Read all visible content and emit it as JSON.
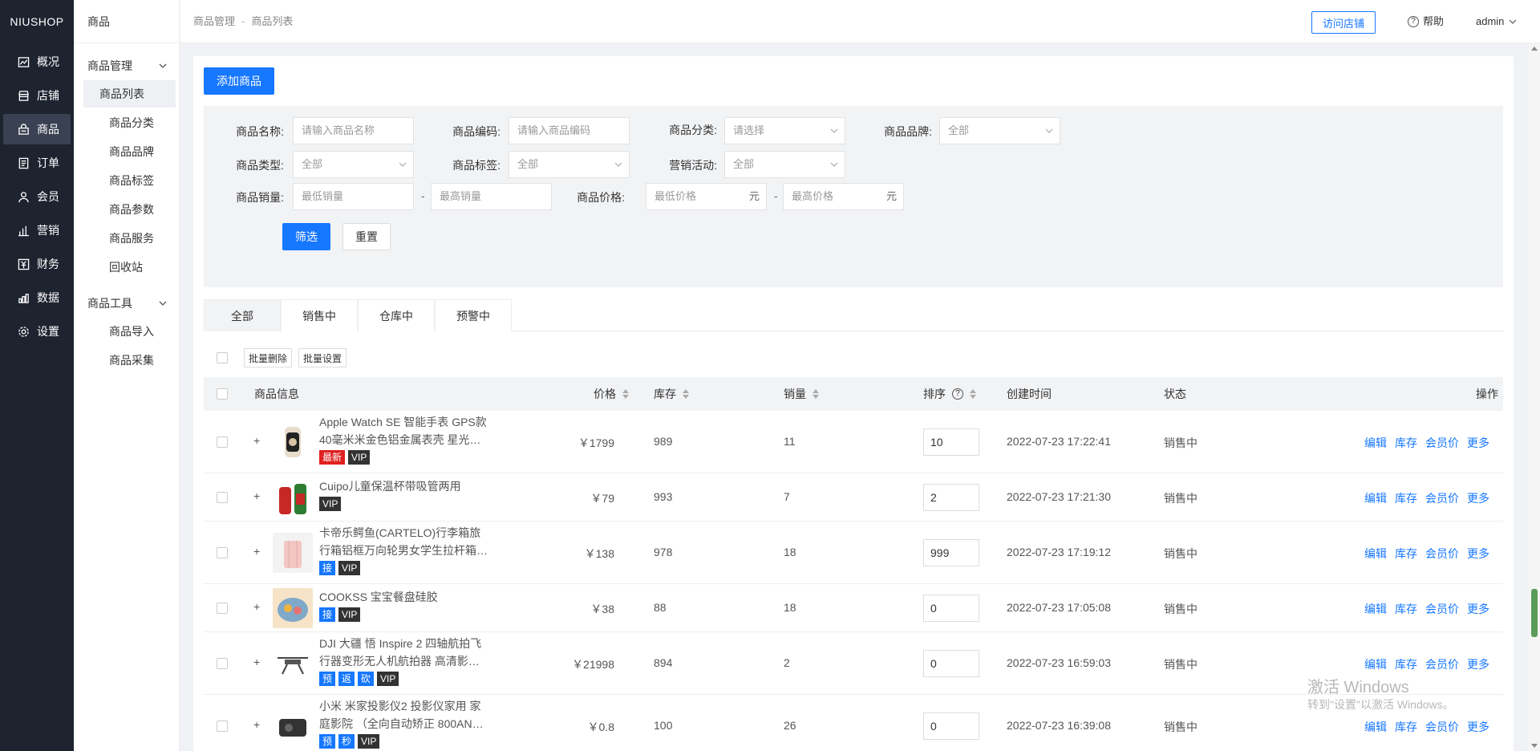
{
  "logo": "NIUSHOP",
  "nav_primary": [
    {
      "label": "概况",
      "icon": "chart-icon"
    },
    {
      "label": "店铺",
      "icon": "store-icon"
    },
    {
      "label": "商品",
      "icon": "goods-icon",
      "active": true
    },
    {
      "label": "订单",
      "icon": "order-icon"
    },
    {
      "label": "会员",
      "icon": "member-icon"
    },
    {
      "label": "营销",
      "icon": "marketing-icon"
    },
    {
      "label": "财务",
      "icon": "finance-icon"
    },
    {
      "label": "数据",
      "icon": "data-icon"
    },
    {
      "label": "设置",
      "icon": "settings-icon"
    }
  ],
  "nav_secondary": {
    "title": "商品",
    "group1": {
      "label": "商品管理",
      "items": [
        "商品列表",
        "商品分类",
        "商品品牌",
        "商品标签",
        "商品参数",
        "商品服务",
        "回收站"
      ]
    },
    "group2": {
      "label": "商品工具",
      "items": [
        "商品导入",
        "商品采集"
      ]
    }
  },
  "header": {
    "breadcrumb": [
      "商品管理",
      "商品列表"
    ],
    "breadcrumb_sep": "-",
    "visit_store": "访问店铺",
    "help": "帮助",
    "user": "admin"
  },
  "add_button": "添加商品",
  "filter": {
    "name_label": "商品名称:",
    "name_placeholder": "请输入商品名称",
    "code_label": "商品编码:",
    "code_placeholder": "请输入商品编码",
    "category_label": "商品分类:",
    "category_value": "请选择",
    "brand_label": "商品品牌:",
    "brand_value": "全部",
    "type_label": "商品类型:",
    "type_value": "全部",
    "tag_label": "商品标签:",
    "tag_value": "全部",
    "activity_label": "营销活动:",
    "activity_value": "全部",
    "sales_label": "商品销量:",
    "sales_min": "最低销量",
    "sales_max": "最高销量",
    "price_label": "商品价格:",
    "price_min": "最低价格",
    "price_max": "最高价格",
    "price_unit": "元",
    "range_sep": "-",
    "filter_btn": "筛选",
    "reset_btn": "重置"
  },
  "tabs": [
    "全部",
    "销售中",
    "仓库中",
    "预警中"
  ],
  "batch": {
    "delete": "批量删除",
    "settings": "批量设置"
  },
  "columns": {
    "info": "商品信息",
    "price": "价格",
    "stock": "库存",
    "sales": "销量",
    "sort": "排序",
    "sort_help": "?",
    "created": "创建时间",
    "status": "状态",
    "ops": "操作"
  },
  "ops": [
    "编辑",
    "库存",
    "会员价",
    "更多"
  ],
  "rows": [
    {
      "name1": "Apple Watch SE 智能手表 GPS款",
      "name2": "40毫米米金色铝金属表壳 星光…",
      "tags": [
        {
          "t": "最新",
          "c": "red"
        },
        {
          "t": "VIP",
          "c": "dark"
        }
      ],
      "price": "￥1799",
      "stock": "989",
      "sales": "11",
      "sort": "10",
      "created": "2022-07-23 17:22:41",
      "status": "销售中"
    },
    {
      "name1": "Cuipo儿童保温杯带吸管两用",
      "name2": "",
      "tags": [
        {
          "t": "VIP",
          "c": "dark"
        }
      ],
      "price": "￥79",
      "stock": "993",
      "sales": "7",
      "sort": "2",
      "created": "2022-07-23 17:21:30",
      "status": "销售中"
    },
    {
      "name1": "卡帝乐鳄鱼(CARTELO)行李箱旅",
      "name2": "行箱铝框万向轮男女学生拉杆箱…",
      "tags": [
        {
          "t": "接",
          "c": "blue"
        },
        {
          "t": "VIP",
          "c": "dark"
        }
      ],
      "price": "￥138",
      "stock": "978",
      "sales": "18",
      "sort": "999",
      "created": "2022-07-23 17:19:12",
      "status": "销售中"
    },
    {
      "name1": "COOKSS 宝宝餐盘硅胶",
      "name2": "",
      "tags": [
        {
          "t": "接",
          "c": "blue"
        },
        {
          "t": "VIP",
          "c": "dark"
        }
      ],
      "price": "￥38",
      "stock": "88",
      "sales": "18",
      "sort": "0",
      "created": "2022-07-23 17:05:08",
      "status": "销售中"
    },
    {
      "name1": "DJI 大疆 悟 Inspire 2 四轴航拍飞",
      "name2": "行器变形无人机航拍器 高清影…",
      "tags": [
        {
          "t": "预",
          "c": "blue"
        },
        {
          "t": "返",
          "c": "blue"
        },
        {
          "t": "砍",
          "c": "blue"
        },
        {
          "t": "VIP",
          "c": "dark"
        }
      ],
      "price": "￥21998",
      "stock": "894",
      "sales": "2",
      "sort": "0",
      "created": "2022-07-23 16:59:03",
      "status": "销售中"
    },
    {
      "name1": "小米 米家投影仪2 投影仪家用 家",
      "name2": "庭影院 （全向自动矫正 800AN…",
      "tags": [
        {
          "t": "预",
          "c": "blue"
        },
        {
          "t": "秒",
          "c": "blue"
        },
        {
          "t": "VIP",
          "c": "dark"
        }
      ],
      "price": "￥0.8",
      "stock": "100",
      "sales": "26",
      "sort": "0",
      "created": "2022-07-23 16:39:08",
      "status": "销售中"
    }
  ],
  "watermark": {
    "line1": "激活 Windows",
    "line2": "转到\"设置\"以激活 Windows。"
  },
  "colors": {
    "primary": "#1677ff",
    "sidebar": "#1e2330",
    "tag_red": "#e02020",
    "tag_dark": "#333333"
  }
}
